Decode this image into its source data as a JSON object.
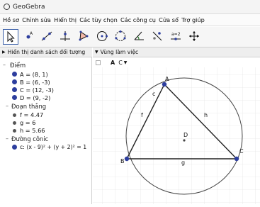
{
  "window": {
    "title": "GeoGebra"
  },
  "menu": [
    "Hồ sơ",
    "Chỉnh sửa",
    "Hiển thị",
    "Các tùy chọn",
    "Các công cụ",
    "Cửa sổ",
    "Trợ giúp"
  ],
  "toolbar": {
    "tools": [
      "move-tool",
      "point-tool",
      "line-tool",
      "perpendicular-tool",
      "polygon-tool",
      "circle-tool",
      "circle-three-points-tool",
      "angle-tool",
      "reflect-tool",
      "slider-tool",
      "move-graphics-tool"
    ]
  },
  "algebra_panel": {
    "header": "Hiển thị danh sách đối tượng",
    "groups": [
      {
        "label": "Điểm",
        "items": [
          "A = (8, 1)",
          "B = (6, -3)",
          "C = (12, -3)",
          "D = (9, -2)"
        ]
      },
      {
        "label": "Đoạn thẳng",
        "items": [
          "f = 4.47",
          "g = 6",
          "h = 5.66"
        ]
      },
      {
        "label": "Đường cônic",
        "items": [
          "c: (x - 9)² + (y + 2)² = 1"
        ]
      }
    ]
  },
  "graphics_panel": {
    "header": "Vùng làm việc",
    "style_label": "A",
    "style_label2": "C",
    "labels": {
      "A": "A",
      "B": "B",
      "C": "C",
      "D": "D",
      "f": "f",
      "g": "g",
      "h": "h",
      "c": "c"
    }
  },
  "colors": {
    "point": "#2d3e9e",
    "accent": "#3a5fa8",
    "grid": "#e6e6e6"
  }
}
